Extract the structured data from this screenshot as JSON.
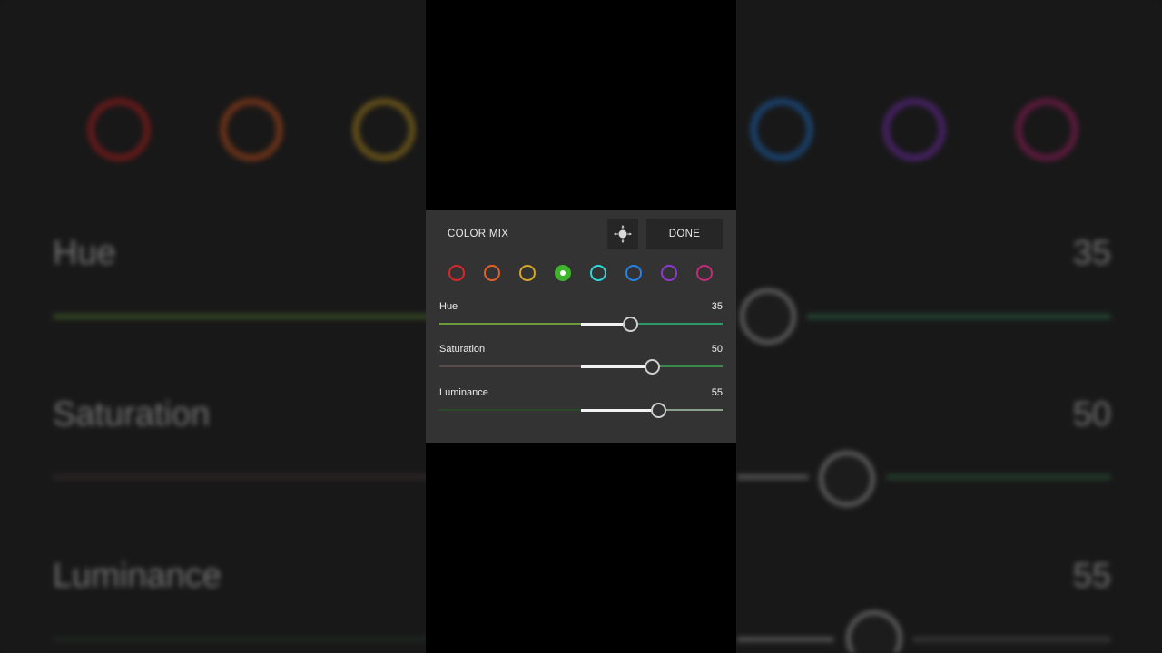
{
  "panel": {
    "title": "COLOR MIX",
    "done_label": "DONE",
    "target_icon": "target-adjust-icon"
  },
  "swatches": [
    {
      "name": "red",
      "color": "#d8262a",
      "selected": false
    },
    {
      "name": "orange",
      "color": "#e0602a",
      "selected": false
    },
    {
      "name": "yellow",
      "color": "#d4a62a",
      "selected": false
    },
    {
      "name": "green",
      "color": "#3fb22e",
      "selected": true
    },
    {
      "name": "aqua",
      "color": "#2fd8d8",
      "selected": false
    },
    {
      "name": "blue",
      "color": "#2a82e0",
      "selected": false
    },
    {
      "name": "purple",
      "color": "#8e3ad0",
      "selected": false
    },
    {
      "name": "magenta",
      "color": "#c42a7a",
      "selected": false
    }
  ],
  "sliders": [
    {
      "label": "Hue",
      "value": "35",
      "position": 0.675
    },
    {
      "label": "Saturation",
      "value": "50",
      "position": 0.75
    },
    {
      "label": "Luminance",
      "value": "55",
      "position": 0.775
    }
  ],
  "background": {
    "hue_label": "Hue",
    "hue_value": "35",
    "saturation_label": "Saturation",
    "saturation_value": "50",
    "luminance_label": "Luminance",
    "luminance_value": "55"
  }
}
